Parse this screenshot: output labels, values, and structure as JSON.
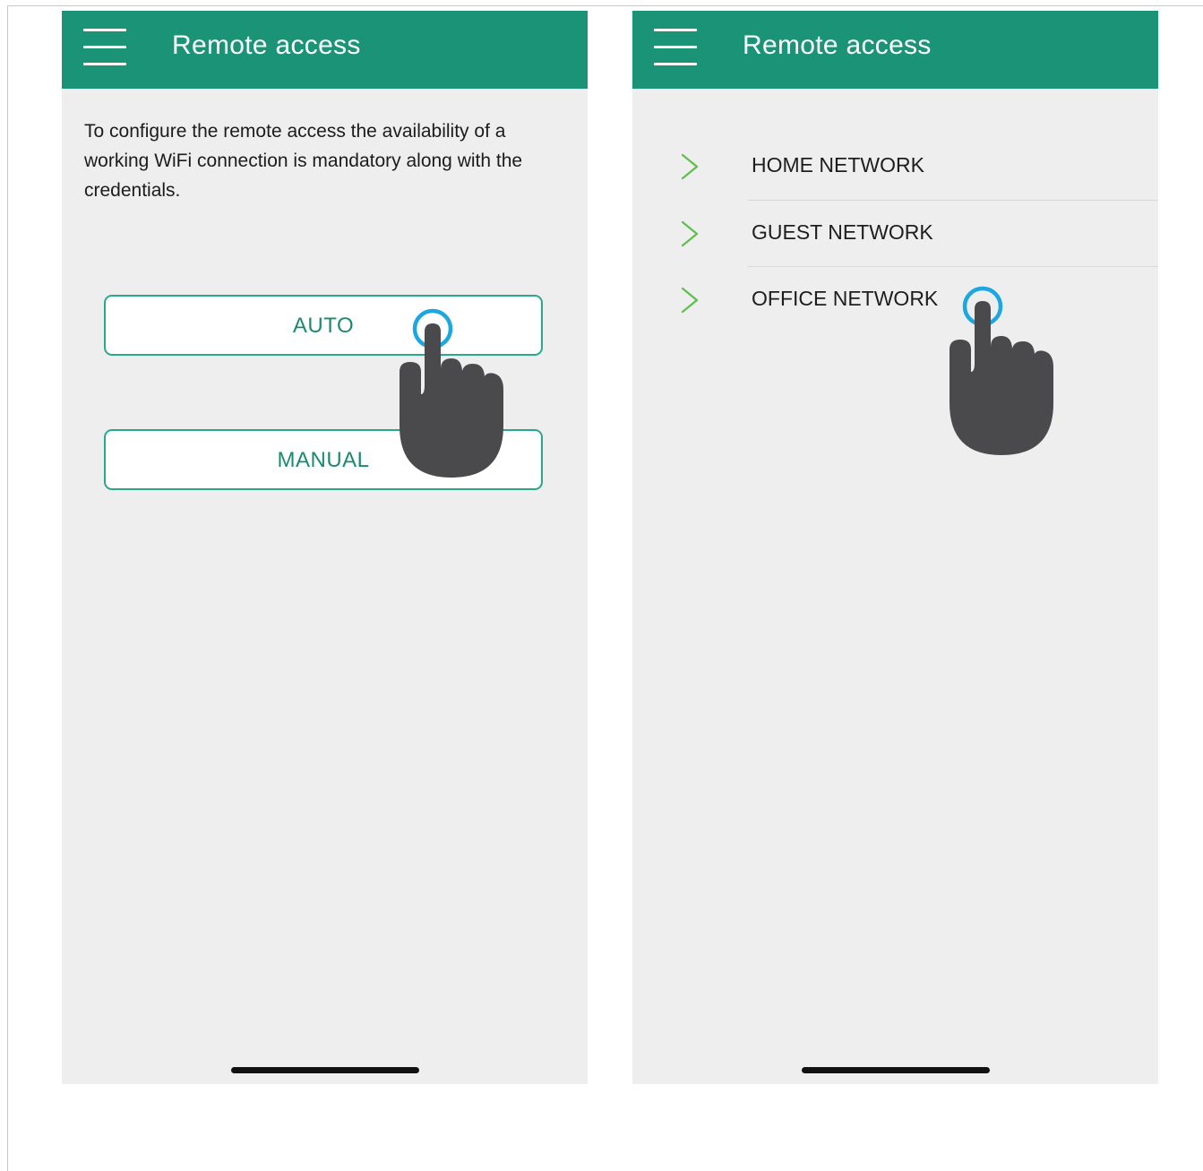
{
  "screens": [
    {
      "title": "Remote access",
      "menu_icon": "hamburger-menu-icon",
      "info_text": "To configure the remote access the availability of a working WiFi connection is mandatory along with the credentials.",
      "buttons": {
        "auto": "AUTO",
        "manual": "MANUAL"
      }
    },
    {
      "title": "Remote access",
      "menu_icon": "hamburger-menu-icon",
      "networks": [
        {
          "label": "HOME NETWORK",
          "icon": "chevron-right-icon"
        },
        {
          "label": "GUEST NETWORK",
          "icon": "chevron-right-icon"
        },
        {
          "label": "OFFICE NETWORK",
          "icon": "chevron-right-icon"
        }
      ]
    }
  ],
  "colors": {
    "app_bar": "#1a9377",
    "background": "#edeeed",
    "button_border": "#2aa88c",
    "button_text": "#1b8a70",
    "chevron": "#5bbf4a",
    "tap_ring": "#1da7e0",
    "hand": "#4a4a4c"
  }
}
